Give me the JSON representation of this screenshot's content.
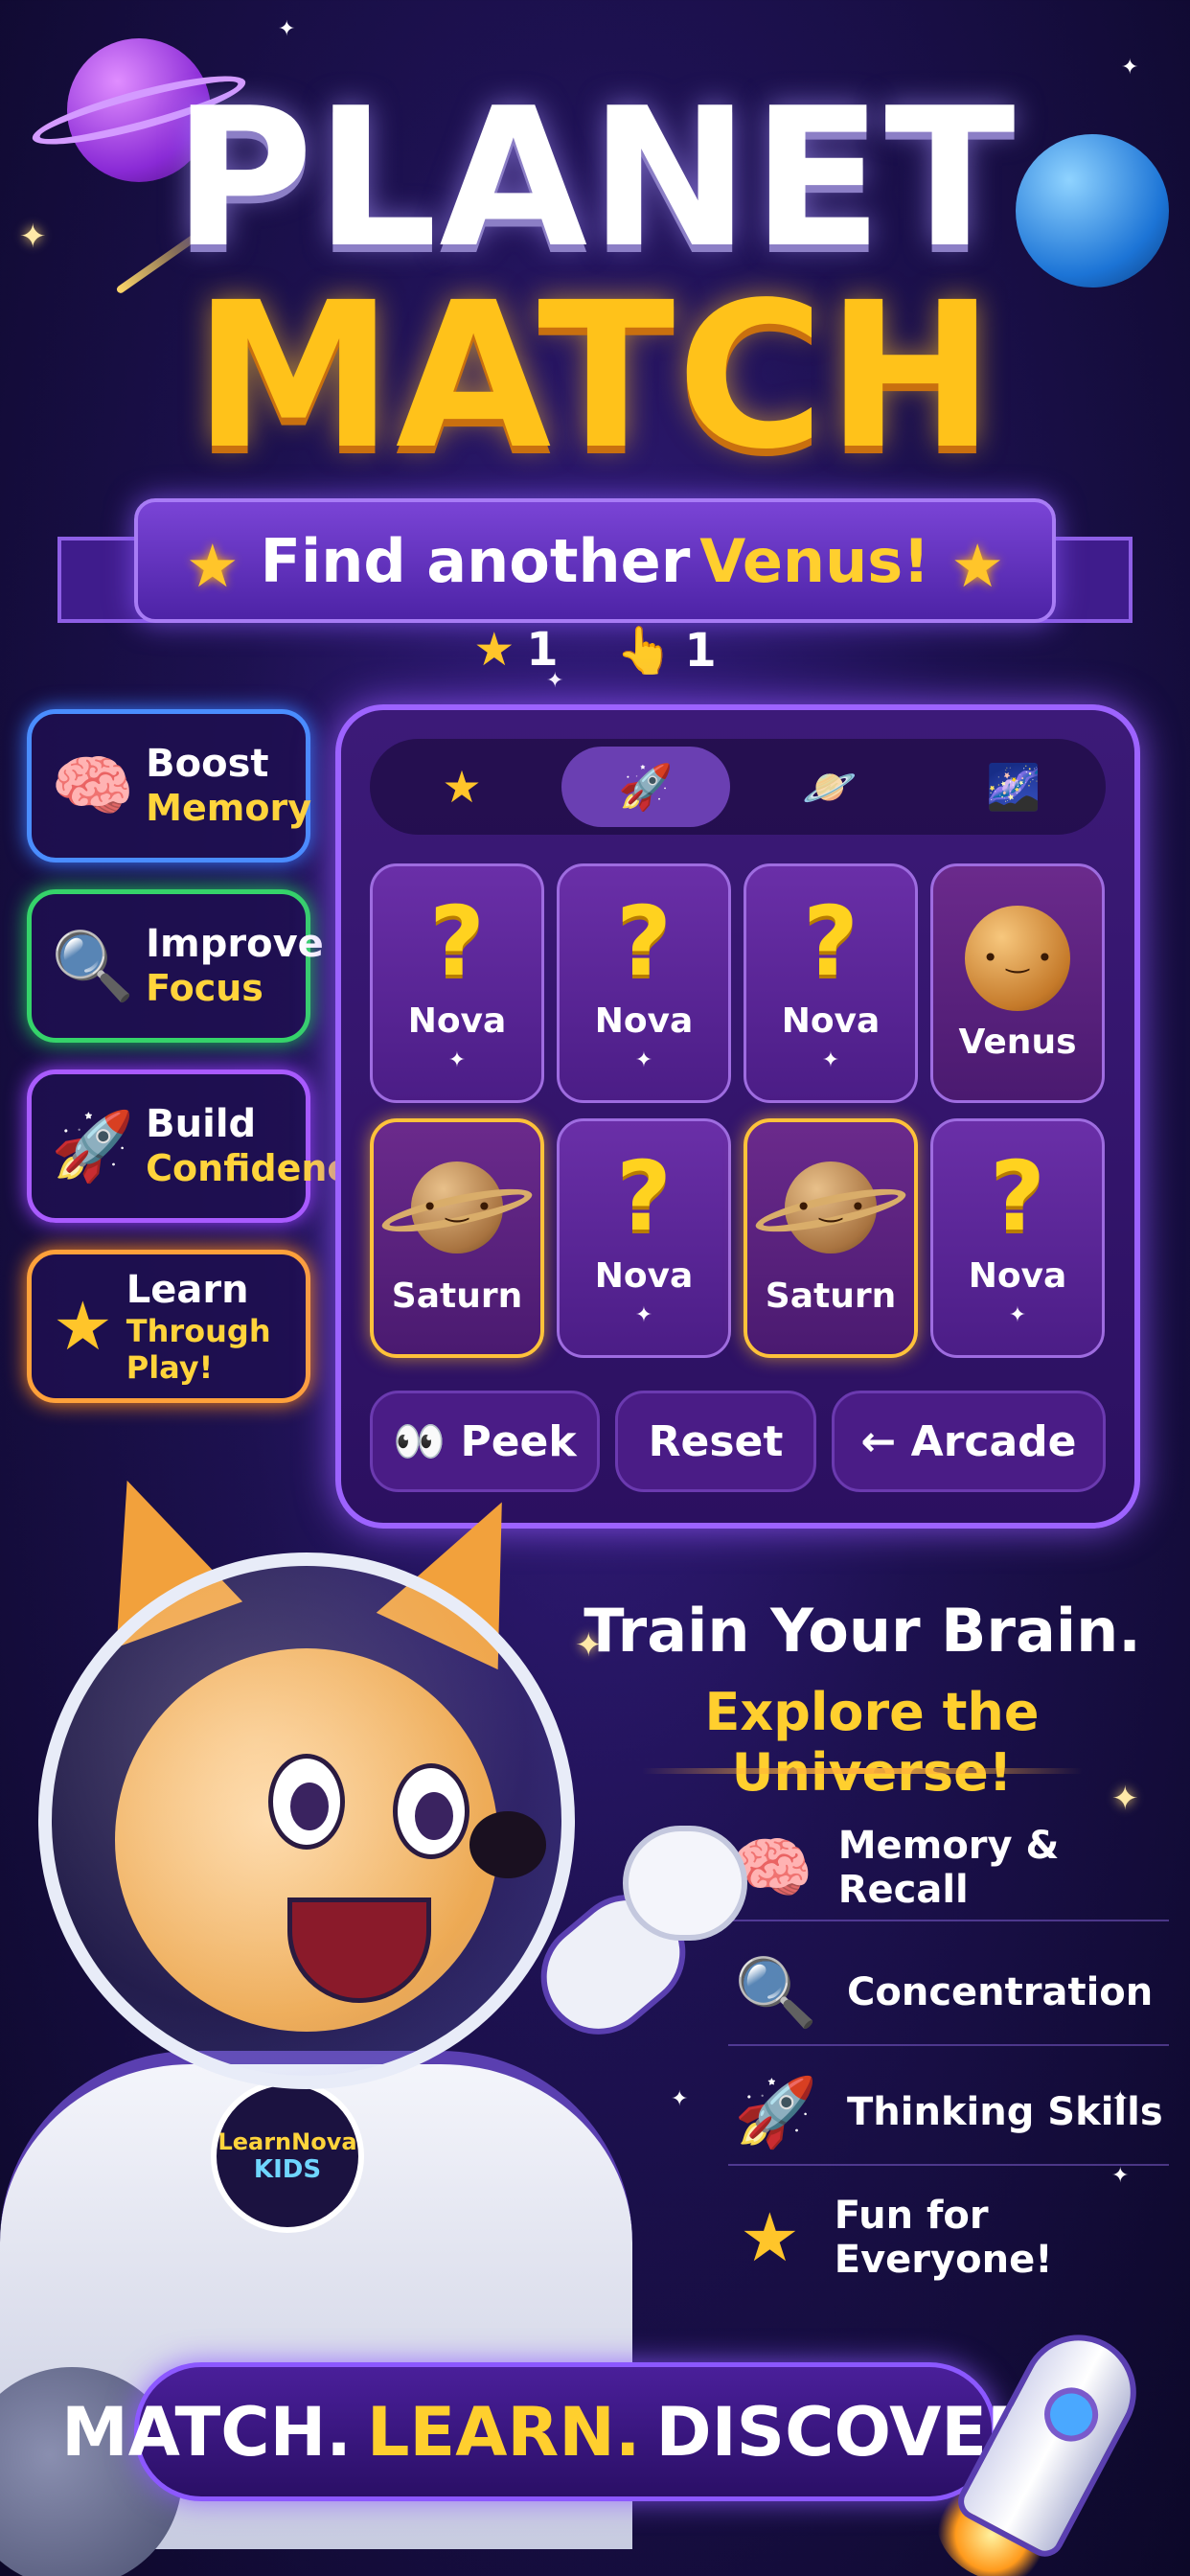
{
  "title": {
    "line1": "PLANET",
    "line2": "MATCH"
  },
  "prompt": {
    "prefix": "Find another",
    "target": "Venus!"
  },
  "stats": {
    "stars": "1",
    "taps": "1"
  },
  "features_left": [
    {
      "icon": "brain-icon",
      "line1": "Boost",
      "line2": "Memory"
    },
    {
      "icon": "magnifier-icon",
      "line1": "Improve",
      "line2": "Focus"
    },
    {
      "icon": "rocket-icon",
      "line1": "Build",
      "line2": "Confidence"
    },
    {
      "icon": "star-icon",
      "line1": "Learn",
      "line2": "Through Play!"
    }
  ],
  "tabs": [
    {
      "icon": "star-icon",
      "glyph": "★",
      "active": false
    },
    {
      "icon": "rocket-icon",
      "glyph": "🚀",
      "active": true
    },
    {
      "icon": "planet-icon",
      "glyph": "🪐",
      "active": false
    },
    {
      "icon": "galaxy-icon",
      "glyph": "🌌",
      "active": false
    }
  ],
  "cards": [
    {
      "label": "Nova",
      "state": "hidden"
    },
    {
      "label": "Nova",
      "state": "hidden"
    },
    {
      "label": "Nova",
      "state": "hidden"
    },
    {
      "label": "Venus",
      "state": "venus"
    },
    {
      "label": "Saturn",
      "state": "saturn"
    },
    {
      "label": "Nova",
      "state": "hidden"
    },
    {
      "label": "Saturn",
      "state": "saturn"
    },
    {
      "label": "Nova",
      "state": "hidden"
    }
  ],
  "actions": {
    "peek": "👀 Peek",
    "reset": "Reset",
    "arcade": "← Arcade"
  },
  "tagline": {
    "line1": "Train Your Brain.",
    "line2": "Explore the Universe!"
  },
  "features_right": [
    {
      "icon": "brain-icon",
      "label": "Memory & Recall"
    },
    {
      "icon": "magnifier-icon",
      "label": "Concentration"
    },
    {
      "icon": "rocket-icon",
      "label": "Thinking Skills"
    },
    {
      "icon": "star-icon",
      "label": "Fun for Everyone!"
    }
  ],
  "badge": {
    "line1": "LearnNova",
    "line2": "KIDS"
  },
  "bottom": {
    "w1": "MATCH.",
    "w2": "LEARN.",
    "w3": "DISCOVER!"
  },
  "colors": {
    "accent": "#ffcf2e",
    "panel": "#9d63ff",
    "bg": "#1d1150"
  }
}
